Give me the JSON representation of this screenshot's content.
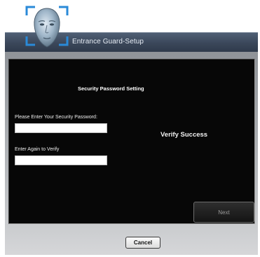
{
  "window": {
    "title": "Entrance Guard-Setup",
    "logo_icon": "face-scan-icon"
  },
  "panel": {
    "heading": "Security Password Setting",
    "password_label": "Please Enter Your Security Password:",
    "password_value": "",
    "verify_label": "Enter Again to Verify",
    "verify_value": "",
    "status_text": "Verify Success",
    "next_label": "Next"
  },
  "footer": {
    "cancel_label": "Cancel"
  },
  "colors": {
    "titlebar": "#3a4659",
    "panel_bg": "#070707",
    "frame_bg": "#c5c7ca",
    "logo_blue": "#2a8ad8"
  }
}
